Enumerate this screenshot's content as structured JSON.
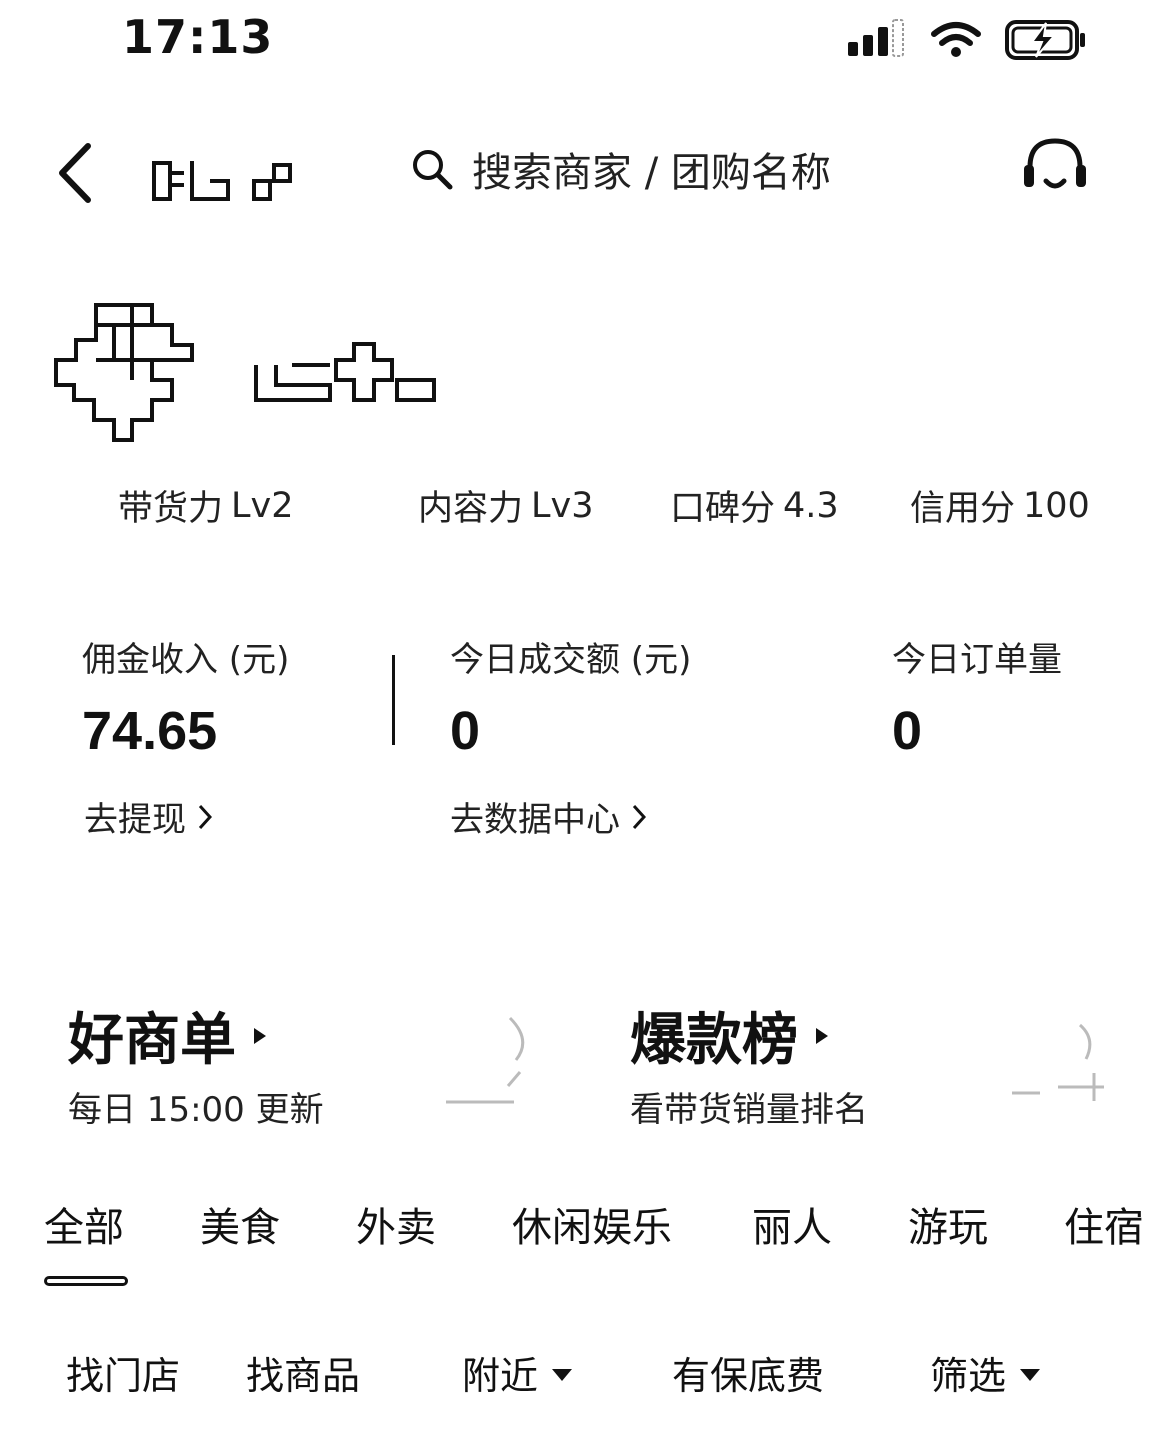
{
  "status_bar": {
    "time": "17:13"
  },
  "header": {
    "search_placeholder": "搜索商家 / 团购名称"
  },
  "profile": {
    "metrics": [
      {
        "label": "带货力",
        "value": "Lv2"
      },
      {
        "label": "内容力",
        "value": "Lv3"
      },
      {
        "label": "口碑分",
        "value": "4.3"
      },
      {
        "label": "信用分",
        "value": "100"
      }
    ]
  },
  "stats": [
    {
      "label": "佣金收入 (元)",
      "value": "74.65",
      "link": "去提现"
    },
    {
      "label": "今日成交额 (元)",
      "value": "0",
      "link": "去数据中心"
    },
    {
      "label": "今日订单量",
      "value": "0"
    }
  ],
  "promos": [
    {
      "title": "好商单",
      "subtitle": "每日 15:00 更新"
    },
    {
      "title": "爆款榜",
      "subtitle": "看带货销量排名"
    }
  ],
  "categories": [
    "全部",
    "美食",
    "外卖",
    "休闲娱乐",
    "丽人",
    "游玩",
    "住宿"
  ],
  "filters": [
    "找门店",
    "找商品",
    "附近",
    "有保底费",
    "筛选"
  ]
}
